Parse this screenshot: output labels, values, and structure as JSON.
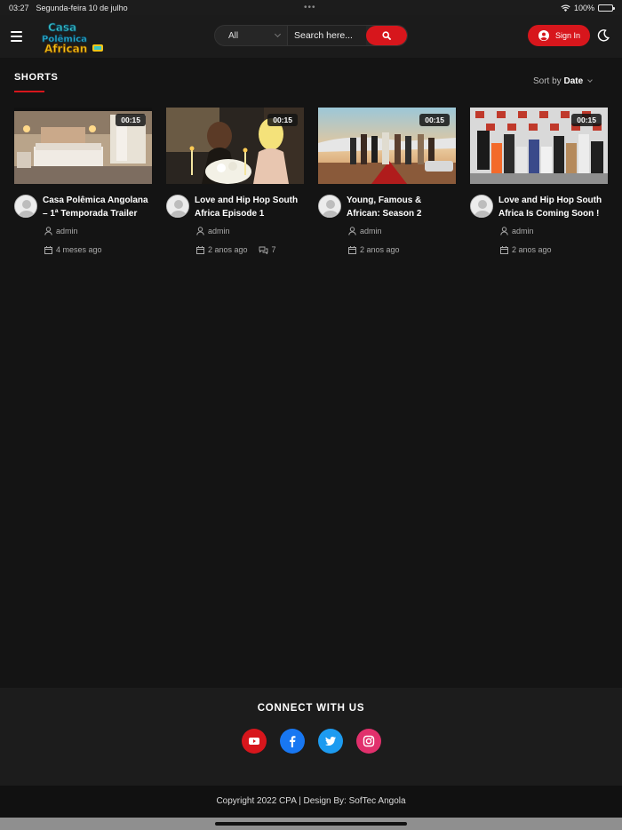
{
  "status_bar": {
    "time": "03:27",
    "date": "Segunda-feira 10 de julho",
    "battery": "100%"
  },
  "header": {
    "logo_text": [
      "Casa",
      "Polêmica",
      "African"
    ],
    "search": {
      "category": "All",
      "placeholder": "Search here..."
    },
    "signin_label": "Sign In"
  },
  "section": {
    "title": "SHORTS",
    "sort_prefix": "Sort by",
    "sort_value": "Date"
  },
  "videos": [
    {
      "title": "Casa Polêmica Angolana – 1ª Temporada Trailer",
      "duration": "00:15",
      "author": "admin",
      "date": "4 meses ago",
      "comments": ""
    },
    {
      "title": "Love and Hip Hop South Africa Episode 1",
      "duration": "00:15",
      "author": "admin",
      "date": "2 anos ago",
      "comments": "7"
    },
    {
      "title": "Young, Famous & African: Season 2",
      "duration": "00:15",
      "author": "admin",
      "date": "2 anos ago",
      "comments": ""
    },
    {
      "title": "Love and Hip Hop South Africa Is Coming Soon !",
      "duration": "00:15",
      "author": "admin",
      "date": "2 anos ago",
      "comments": ""
    }
  ],
  "footer": {
    "connect_title": "CONNECT WITH US",
    "socials": [
      {
        "name": "youtube",
        "color": "#d7161c"
      },
      {
        "name": "facebook",
        "color": "#1877f2"
      },
      {
        "name": "twitter",
        "color": "#1d9bf0"
      },
      {
        "name": "instagram",
        "color": "#e1306c"
      }
    ],
    "copyright": "Copyright 2022 CPA | Design By: SofTec Angola"
  },
  "colors": {
    "accent": "#d7161c",
    "background": "#141414"
  }
}
